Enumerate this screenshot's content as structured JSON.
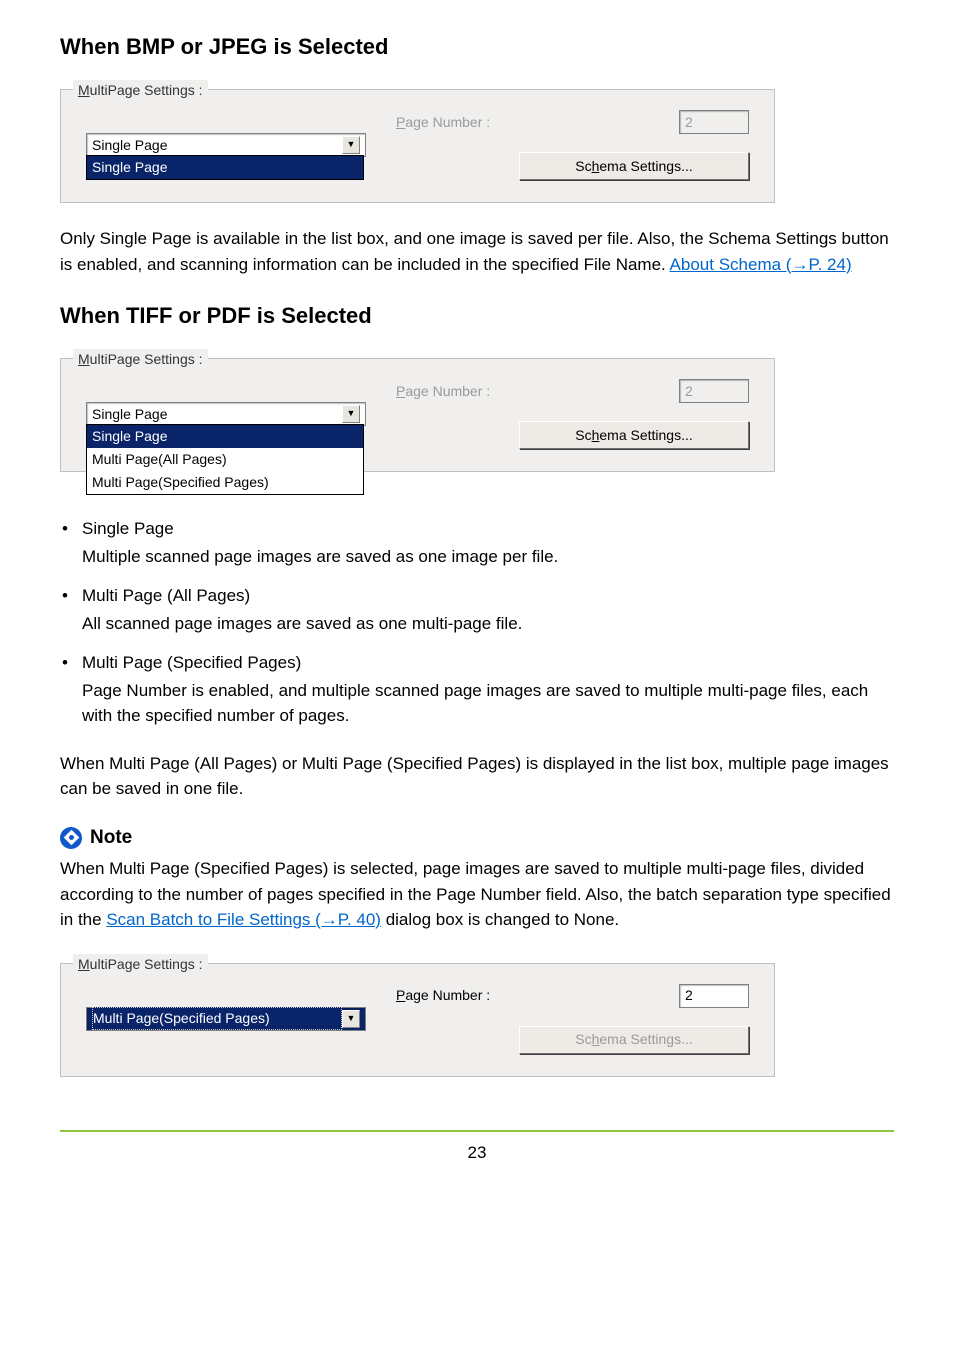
{
  "headings": {
    "bmp_jpeg": "When BMP or JPEG is Selected",
    "tiff_pdf": "When TIFF or PDF is Selected"
  },
  "ui": {
    "legend_prefix": "M",
    "legend_rest": "ultiPage Settings :",
    "page_number_label_p": "P",
    "page_number_label_rest": "age Number :",
    "schema_button_pre": "Sc",
    "schema_button_h": "h",
    "schema_button_post": "ema Settings...",
    "combo_single": "Single Page",
    "dd": {
      "single": "Single Page",
      "all": "Multi Page(All Pages)",
      "spec": "Multi Page(Specified Pages)"
    },
    "num_disabled": "2",
    "num_enabled": "2"
  },
  "paragraphs": {
    "p1_a": "Only Single Page is available in the list box, and one image is saved per file. Also, the Schema Settings button is enabled, and scanning information can be included in the specified File Name. ",
    "p1_link": "About Schema (→P. 24)",
    "p2": "When Multi Page (All Pages) or Multi Page (Specified Pages) is displayed in the list box, multiple page images can be saved in one file.",
    "p3_a": "When Multi Page (Specified Pages) is selected, page images are saved to multiple multi-page files, divided according to the number of pages specified in the Page Number field. Also, the batch separation type specified in the ",
    "p3_link": "Scan Batch to File Settings  (→P. 40)",
    "p3_b": " dialog box is changed to None."
  },
  "bullets": {
    "b1_title": "Single Page",
    "b1_desc": "Multiple scanned page images are saved as one image per file.",
    "b2_title": "Multi Page (All Pages)",
    "b2_desc": "All scanned page images are saved as one multi-page file.",
    "b3_title": "Multi Page (Specified Pages)",
    "b3_desc": "Page Number is enabled, and multiple scanned page images are saved to multiple multi-page files, each with the specified number of pages."
  },
  "note_label": "Note",
  "page_number": "23"
}
